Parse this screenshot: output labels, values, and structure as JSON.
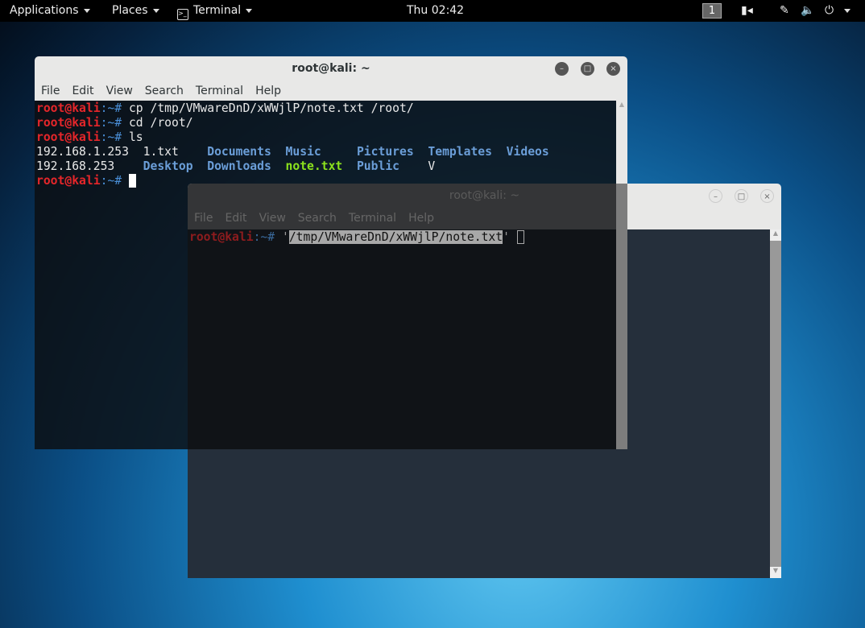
{
  "topbar": {
    "applications": "Applications",
    "places": "Places",
    "terminal": "Terminal",
    "clock": "Thu 02:42",
    "workspace": "1",
    "icons": [
      "camera-icon",
      "pen-icon",
      "volume-icon",
      "power-icon"
    ]
  },
  "back_window": {
    "title": "root@kali: ~",
    "menu": [
      "File",
      "Edit",
      "View",
      "Search",
      "Terminal",
      "Help"
    ],
    "prompt_user": "root@kali",
    "prompt_sep": ":~# ",
    "command_quote_open": "'",
    "command_path": "/tmp/VMwareDnD/xWWjlP/note.txt",
    "command_quote_close": "'"
  },
  "front_window": {
    "title": "root@kali: ~",
    "menu": [
      "File",
      "Edit",
      "View",
      "Search",
      "Terminal",
      "Help"
    ],
    "prompt_user": "root@kali",
    "prompt_sep": ":~# ",
    "lines": [
      {
        "cmd": "cp /tmp/VMwareDnD/xWWjlP/note.txt /root/"
      },
      {
        "cmd": "cd /root/"
      },
      {
        "cmd": "ls"
      }
    ],
    "ls_rows": [
      [
        {
          "t": "192.168.1.253  ",
          "c": "w"
        },
        {
          "t": "1.txt    ",
          "c": "w"
        },
        {
          "t": "Documents",
          "c": "blue"
        },
        {
          "t": "  ",
          "c": "w"
        },
        {
          "t": "Music",
          "c": "blue"
        },
        {
          "t": "     ",
          "c": "w"
        },
        {
          "t": "Pictures",
          "c": "blue"
        },
        {
          "t": "  ",
          "c": "w"
        },
        {
          "t": "Templates",
          "c": "blue"
        },
        {
          "t": "  ",
          "c": "w"
        },
        {
          "t": "Videos",
          "c": "blue"
        }
      ],
      [
        {
          "t": "192.168.253    ",
          "c": "w"
        },
        {
          "t": "Desktop",
          "c": "blue"
        },
        {
          "t": "  ",
          "c": "w"
        },
        {
          "t": "Downloads",
          "c": "blue"
        },
        {
          "t": "  ",
          "c": "w"
        },
        {
          "t": "note.txt",
          "c": "green"
        },
        {
          "t": "  ",
          "c": "w"
        },
        {
          "t": "Public",
          "c": "blue"
        },
        {
          "t": "    ",
          "c": "w"
        },
        {
          "t": "V",
          "c": "w"
        }
      ]
    ]
  },
  "colors": {
    "prompt": "#e5262a",
    "directory": "#6b9ed8",
    "file_green": "#8be11d"
  }
}
